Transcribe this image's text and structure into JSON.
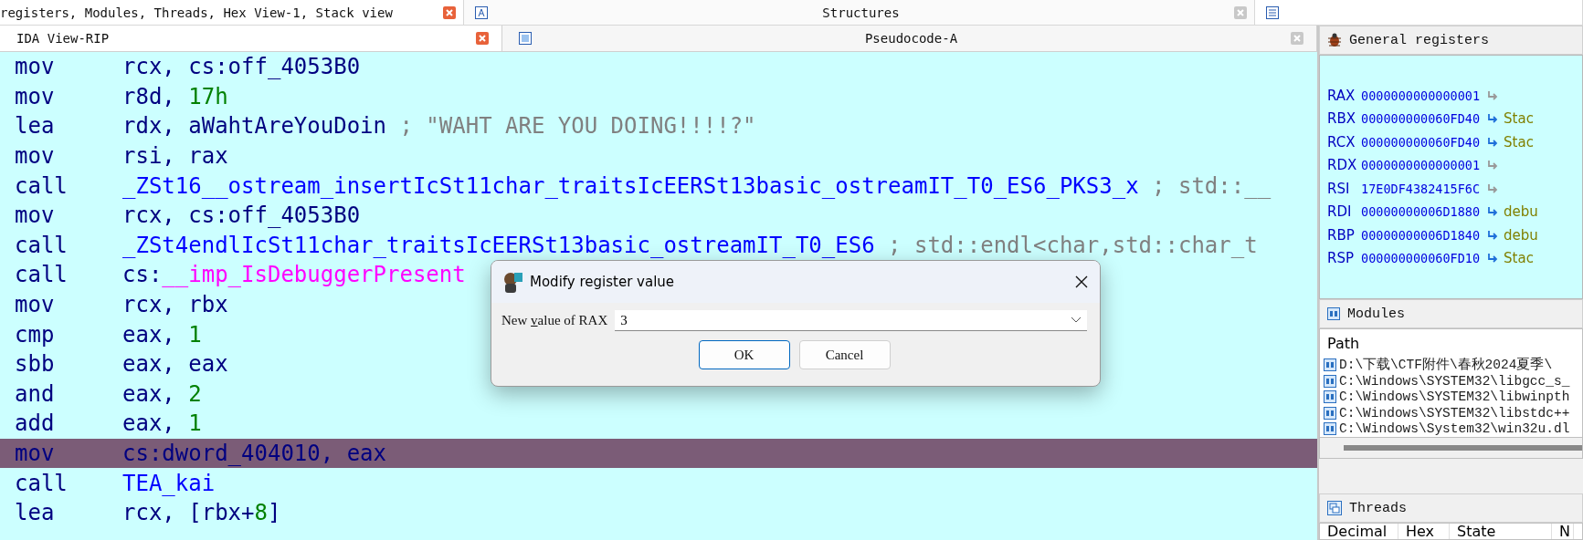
{
  "top_tabs": [
    {
      "label": "registers, Modules, Threads, Hex View-1, Stack view",
      "selected": true
    },
    {
      "label": "Structures",
      "selected": false
    }
  ],
  "view_tabs": [
    {
      "label": "IDA View-RIP",
      "selected": true
    },
    {
      "label": "Pseudocode-A",
      "selected": false
    }
  ],
  "code_lines": [
    {
      "mnemonic": "mov",
      "highlighted": false,
      "operand": [
        {
          "kind": "plain",
          "text": "rcx, cs:off_4053B0"
        }
      ]
    },
    {
      "mnemonic": "mov",
      "highlighted": false,
      "operand": [
        {
          "kind": "plain",
          "text": "r8d, "
        },
        {
          "kind": "number",
          "text": "17h"
        }
      ]
    },
    {
      "mnemonic": "lea",
      "highlighted": false,
      "operand": [
        {
          "kind": "plain",
          "text": "rdx, aWahtAreYouDoin"
        },
        {
          "kind": "comment",
          "text": " ; \"WAHT ARE YOU DOING!!!!?\""
        }
      ]
    },
    {
      "mnemonic": "mov",
      "highlighted": false,
      "operand": [
        {
          "kind": "plain",
          "text": "rsi, rax"
        }
      ]
    },
    {
      "mnemonic": "call",
      "highlighted": false,
      "operand": [
        {
          "kind": "name",
          "text": "_ZSt16__ostream_insertIcSt11char_traitsIcEERSt13basic_ostreamIT_T0_ES6_PKS3_x"
        },
        {
          "kind": "comment",
          "text": " ; std::__"
        }
      ]
    },
    {
      "mnemonic": "mov",
      "highlighted": false,
      "operand": [
        {
          "kind": "plain",
          "text": "rcx, cs:off_4053B0"
        }
      ]
    },
    {
      "mnemonic": "call",
      "highlighted": false,
      "operand": [
        {
          "kind": "name",
          "text": "_ZSt4endlIcSt11char_traitsIcEERSt13basic_ostreamIT_T0_ES6"
        },
        {
          "kind": "comment",
          "text": "  ; std::endl<char,std::char_t"
        }
      ]
    },
    {
      "mnemonic": "call",
      "highlighted": false,
      "operand": [
        {
          "kind": "plain",
          "text": "cs:"
        },
        {
          "kind": "import",
          "text": "__imp_IsDebuggerPresent"
        }
      ]
    },
    {
      "mnemonic": "mov",
      "highlighted": false,
      "operand": [
        {
          "kind": "plain",
          "text": "rcx, rbx"
        }
      ]
    },
    {
      "mnemonic": "cmp",
      "highlighted": false,
      "operand": [
        {
          "kind": "plain",
          "text": "eax, "
        },
        {
          "kind": "number",
          "text": "1"
        }
      ]
    },
    {
      "mnemonic": "sbb",
      "highlighted": false,
      "operand": [
        {
          "kind": "plain",
          "text": "eax, eax"
        }
      ]
    },
    {
      "mnemonic": "and",
      "highlighted": false,
      "operand": [
        {
          "kind": "plain",
          "text": "eax, "
        },
        {
          "kind": "number",
          "text": "2"
        }
      ]
    },
    {
      "mnemonic": "add",
      "highlighted": false,
      "operand": [
        {
          "kind": "plain",
          "text": "eax, "
        },
        {
          "kind": "number",
          "text": "1"
        }
      ]
    },
    {
      "mnemonic": "mov",
      "highlighted": true,
      "operand": [
        {
          "kind": "plain",
          "text": "cs:dword_404010, eax"
        }
      ]
    },
    {
      "mnemonic": "call",
      "highlighted": false,
      "operand": [
        {
          "kind": "name",
          "text": "TEA_kai"
        }
      ]
    },
    {
      "mnemonic": "lea",
      "highlighted": false,
      "operand": [
        {
          "kind": "plain",
          "text": "rcx, [rbx+"
        },
        {
          "kind": "number",
          "text": "8"
        },
        {
          "kind": "plain",
          "text": "]"
        }
      ]
    }
  ],
  "dialog": {
    "title": "Modify register value",
    "label": "New value of RAX",
    "value": "3",
    "buttons": [
      {
        "label": "OK",
        "focused": true
      },
      {
        "label": "Cancel",
        "focused": false
      }
    ]
  },
  "registers_panel": {
    "title": "General registers",
    "registers": [
      {
        "name": "RAX",
        "value": "0000000000000001",
        "points_to_memory": false
      },
      {
        "name": "RBX",
        "value": "000000000060FD40",
        "points_to_memory": true,
        "target": "Stac"
      },
      {
        "name": "RCX",
        "value": "000000000060FD40",
        "points_to_memory": true,
        "target": "Stac"
      },
      {
        "name": "RDX",
        "value": "0000000000000001",
        "points_to_memory": false
      },
      {
        "name": "RSI",
        "value": "17E0DF4382415F6C",
        "points_to_memory": false
      },
      {
        "name": "RDI",
        "value": "00000000006D1880",
        "points_to_memory": true,
        "target": "debu"
      },
      {
        "name": "RBP",
        "value": "00000000006D1840",
        "points_to_memory": true,
        "target": "debu"
      },
      {
        "name": "RSP",
        "value": "000000000060FD10",
        "points_to_memory": true,
        "target": "Stac"
      }
    ]
  },
  "modules_panel": {
    "title": "Modules",
    "column": "Path",
    "paths": [
      "D:\\下载\\CTF附件\\春秋2024夏季\\",
      "C:\\Windows\\SYSTEM32\\libgcc_s_",
      "C:\\Windows\\SYSTEM32\\libwinpth",
      "C:\\Windows\\SYSTEM32\\libstdc++",
      "C:\\Windows\\System32\\win32u.dl"
    ]
  },
  "threads_panel": {
    "title": "Threads",
    "columns": [
      "Decimal",
      "Hex",
      "State",
      "N"
    ]
  }
}
